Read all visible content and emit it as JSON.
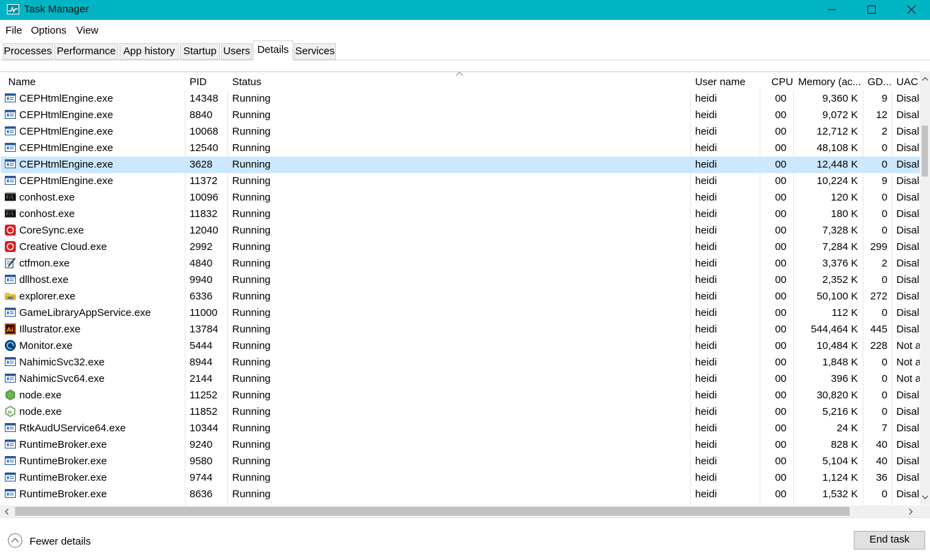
{
  "window": {
    "title": "Task Manager"
  },
  "menu": [
    "File",
    "Options",
    "View"
  ],
  "tabs": [
    "Processes",
    "Performance",
    "App history",
    "Startup",
    "Users",
    "Details",
    "Services"
  ],
  "active_tab": "Details",
  "columns": [
    "Name",
    "PID",
    "Status",
    "User name",
    "CPU",
    "Memory (ac...",
    "GD...",
    "UAC"
  ],
  "rows": [
    {
      "icon": "window-app-icon",
      "name": "CEPHtmlEngine.exe",
      "pid": "14348",
      "status": "Running",
      "user": "heidi",
      "cpu": "00",
      "mem": "9,360 K",
      "gdi": "9",
      "uac": "Disal"
    },
    {
      "icon": "window-app-icon",
      "name": "CEPHtmlEngine.exe",
      "pid": "8840",
      "status": "Running",
      "user": "heidi",
      "cpu": "00",
      "mem": "9,072 K",
      "gdi": "12",
      "uac": "Disal"
    },
    {
      "icon": "window-app-icon",
      "name": "CEPHtmlEngine.exe",
      "pid": "10068",
      "status": "Running",
      "user": "heidi",
      "cpu": "00",
      "mem": "12,712 K",
      "gdi": "2",
      "uac": "Disal"
    },
    {
      "icon": "window-app-icon",
      "name": "CEPHtmlEngine.exe",
      "pid": "12540",
      "status": "Running",
      "user": "heidi",
      "cpu": "00",
      "mem": "48,108 K",
      "gdi": "0",
      "uac": "Disal"
    },
    {
      "icon": "window-app-icon",
      "name": "CEPHtmlEngine.exe",
      "pid": "3628",
      "status": "Running",
      "user": "heidi",
      "cpu": "00",
      "mem": "12,448 K",
      "gdi": "0",
      "uac": "Disal",
      "selected": true
    },
    {
      "icon": "window-app-icon",
      "name": "CEPHtmlEngine.exe",
      "pid": "11372",
      "status": "Running",
      "user": "heidi",
      "cpu": "00",
      "mem": "10,224 K",
      "gdi": "9",
      "uac": "Disal"
    },
    {
      "icon": "console-icon",
      "name": "conhost.exe",
      "pid": "10096",
      "status": "Running",
      "user": "heidi",
      "cpu": "00",
      "mem": "120 K",
      "gdi": "0",
      "uac": "Disal"
    },
    {
      "icon": "console-icon",
      "name": "conhost.exe",
      "pid": "11832",
      "status": "Running",
      "user": "heidi",
      "cpu": "00",
      "mem": "180 K",
      "gdi": "0",
      "uac": "Disal"
    },
    {
      "icon": "creative-cloud-icon",
      "name": "CoreSync.exe",
      "pid": "12040",
      "status": "Running",
      "user": "heidi",
      "cpu": "00",
      "mem": "7,328 K",
      "gdi": "0",
      "uac": "Disal"
    },
    {
      "icon": "creative-cloud-icon",
      "name": "Creative Cloud.exe",
      "pid": "2992",
      "status": "Running",
      "user": "heidi",
      "cpu": "00",
      "mem": "7,284 K",
      "gdi": "299",
      "uac": "Disal"
    },
    {
      "icon": "pen-notepad-icon",
      "name": "ctfmon.exe",
      "pid": "4840",
      "status": "Running",
      "user": "heidi",
      "cpu": "00",
      "mem": "3,376 K",
      "gdi": "2",
      "uac": "Disal"
    },
    {
      "icon": "window-app-icon",
      "name": "dllhost.exe",
      "pid": "9940",
      "status": "Running",
      "user": "heidi",
      "cpu": "00",
      "mem": "2,352 K",
      "gdi": "0",
      "uac": "Disal"
    },
    {
      "icon": "folder-icon",
      "name": "explorer.exe",
      "pid": "6336",
      "status": "Running",
      "user": "heidi",
      "cpu": "00",
      "mem": "50,100 K",
      "gdi": "272",
      "uac": "Disal"
    },
    {
      "icon": "window-app-icon",
      "name": "GameLibraryAppService.exe",
      "pid": "11000",
      "status": "Running",
      "user": "heidi",
      "cpu": "00",
      "mem": "112 K",
      "gdi": "0",
      "uac": "Disal"
    },
    {
      "icon": "illustrator-icon",
      "name": "Illustrator.exe",
      "pid": "13784",
      "status": "Running",
      "user": "heidi",
      "cpu": "00",
      "mem": "544,464 K",
      "gdi": "445",
      "uac": "Disal"
    },
    {
      "icon": "monitor-app-icon",
      "name": "Monitor.exe",
      "pid": "5444",
      "status": "Running",
      "user": "heidi",
      "cpu": "00",
      "mem": "10,484 K",
      "gdi": "228",
      "uac": "Not a"
    },
    {
      "icon": "window-app-icon",
      "name": "NahimicSvc32.exe",
      "pid": "8944",
      "status": "Running",
      "user": "heidi",
      "cpu": "00",
      "mem": "1,848 K",
      "gdi": "0",
      "uac": "Not a"
    },
    {
      "icon": "window-app-icon",
      "name": "NahimicSvc64.exe",
      "pid": "2144",
      "status": "Running",
      "user": "heidi",
      "cpu": "00",
      "mem": "396 K",
      "gdi": "0",
      "uac": "Not a"
    },
    {
      "icon": "node-hexagon-icon",
      "name": "node.exe",
      "pid": "11252",
      "status": "Running",
      "user": "heidi",
      "cpu": "00",
      "mem": "30,820 K",
      "gdi": "0",
      "uac": "Disal"
    },
    {
      "icon": "node-outline-icon",
      "name": "node.exe",
      "pid": "11852",
      "status": "Running",
      "user": "heidi",
      "cpu": "00",
      "mem": "5,216 K",
      "gdi": "0",
      "uac": "Disal"
    },
    {
      "icon": "window-app-icon",
      "name": "RtkAudUService64.exe",
      "pid": "10344",
      "status": "Running",
      "user": "heidi",
      "cpu": "00",
      "mem": "24 K",
      "gdi": "7",
      "uac": "Disal"
    },
    {
      "icon": "window-app-icon",
      "name": "RuntimeBroker.exe",
      "pid": "9240",
      "status": "Running",
      "user": "heidi",
      "cpu": "00",
      "mem": "828 K",
      "gdi": "40",
      "uac": "Disal"
    },
    {
      "icon": "window-app-icon",
      "name": "RuntimeBroker.exe",
      "pid": "9580",
      "status": "Running",
      "user": "heidi",
      "cpu": "00",
      "mem": "5,104 K",
      "gdi": "40",
      "uac": "Disal"
    },
    {
      "icon": "window-app-icon",
      "name": "RuntimeBroker.exe",
      "pid": "9744",
      "status": "Running",
      "user": "heidi",
      "cpu": "00",
      "mem": "1,124 K",
      "gdi": "36",
      "uac": "Disal"
    },
    {
      "icon": "window-app-icon",
      "name": "RuntimeBroker.exe",
      "pid": "8636",
      "status": "Running",
      "user": "heidi",
      "cpu": "00",
      "mem": "1,532 K",
      "gdi": "0",
      "uac": "Disal"
    }
  ],
  "footer": {
    "fewer_details": "Fewer details",
    "end_task": "End task"
  },
  "colors": {
    "titlebar": "#00b4c4",
    "selected_row": "#cce8ff",
    "grid_line": "#e6e6e6"
  }
}
